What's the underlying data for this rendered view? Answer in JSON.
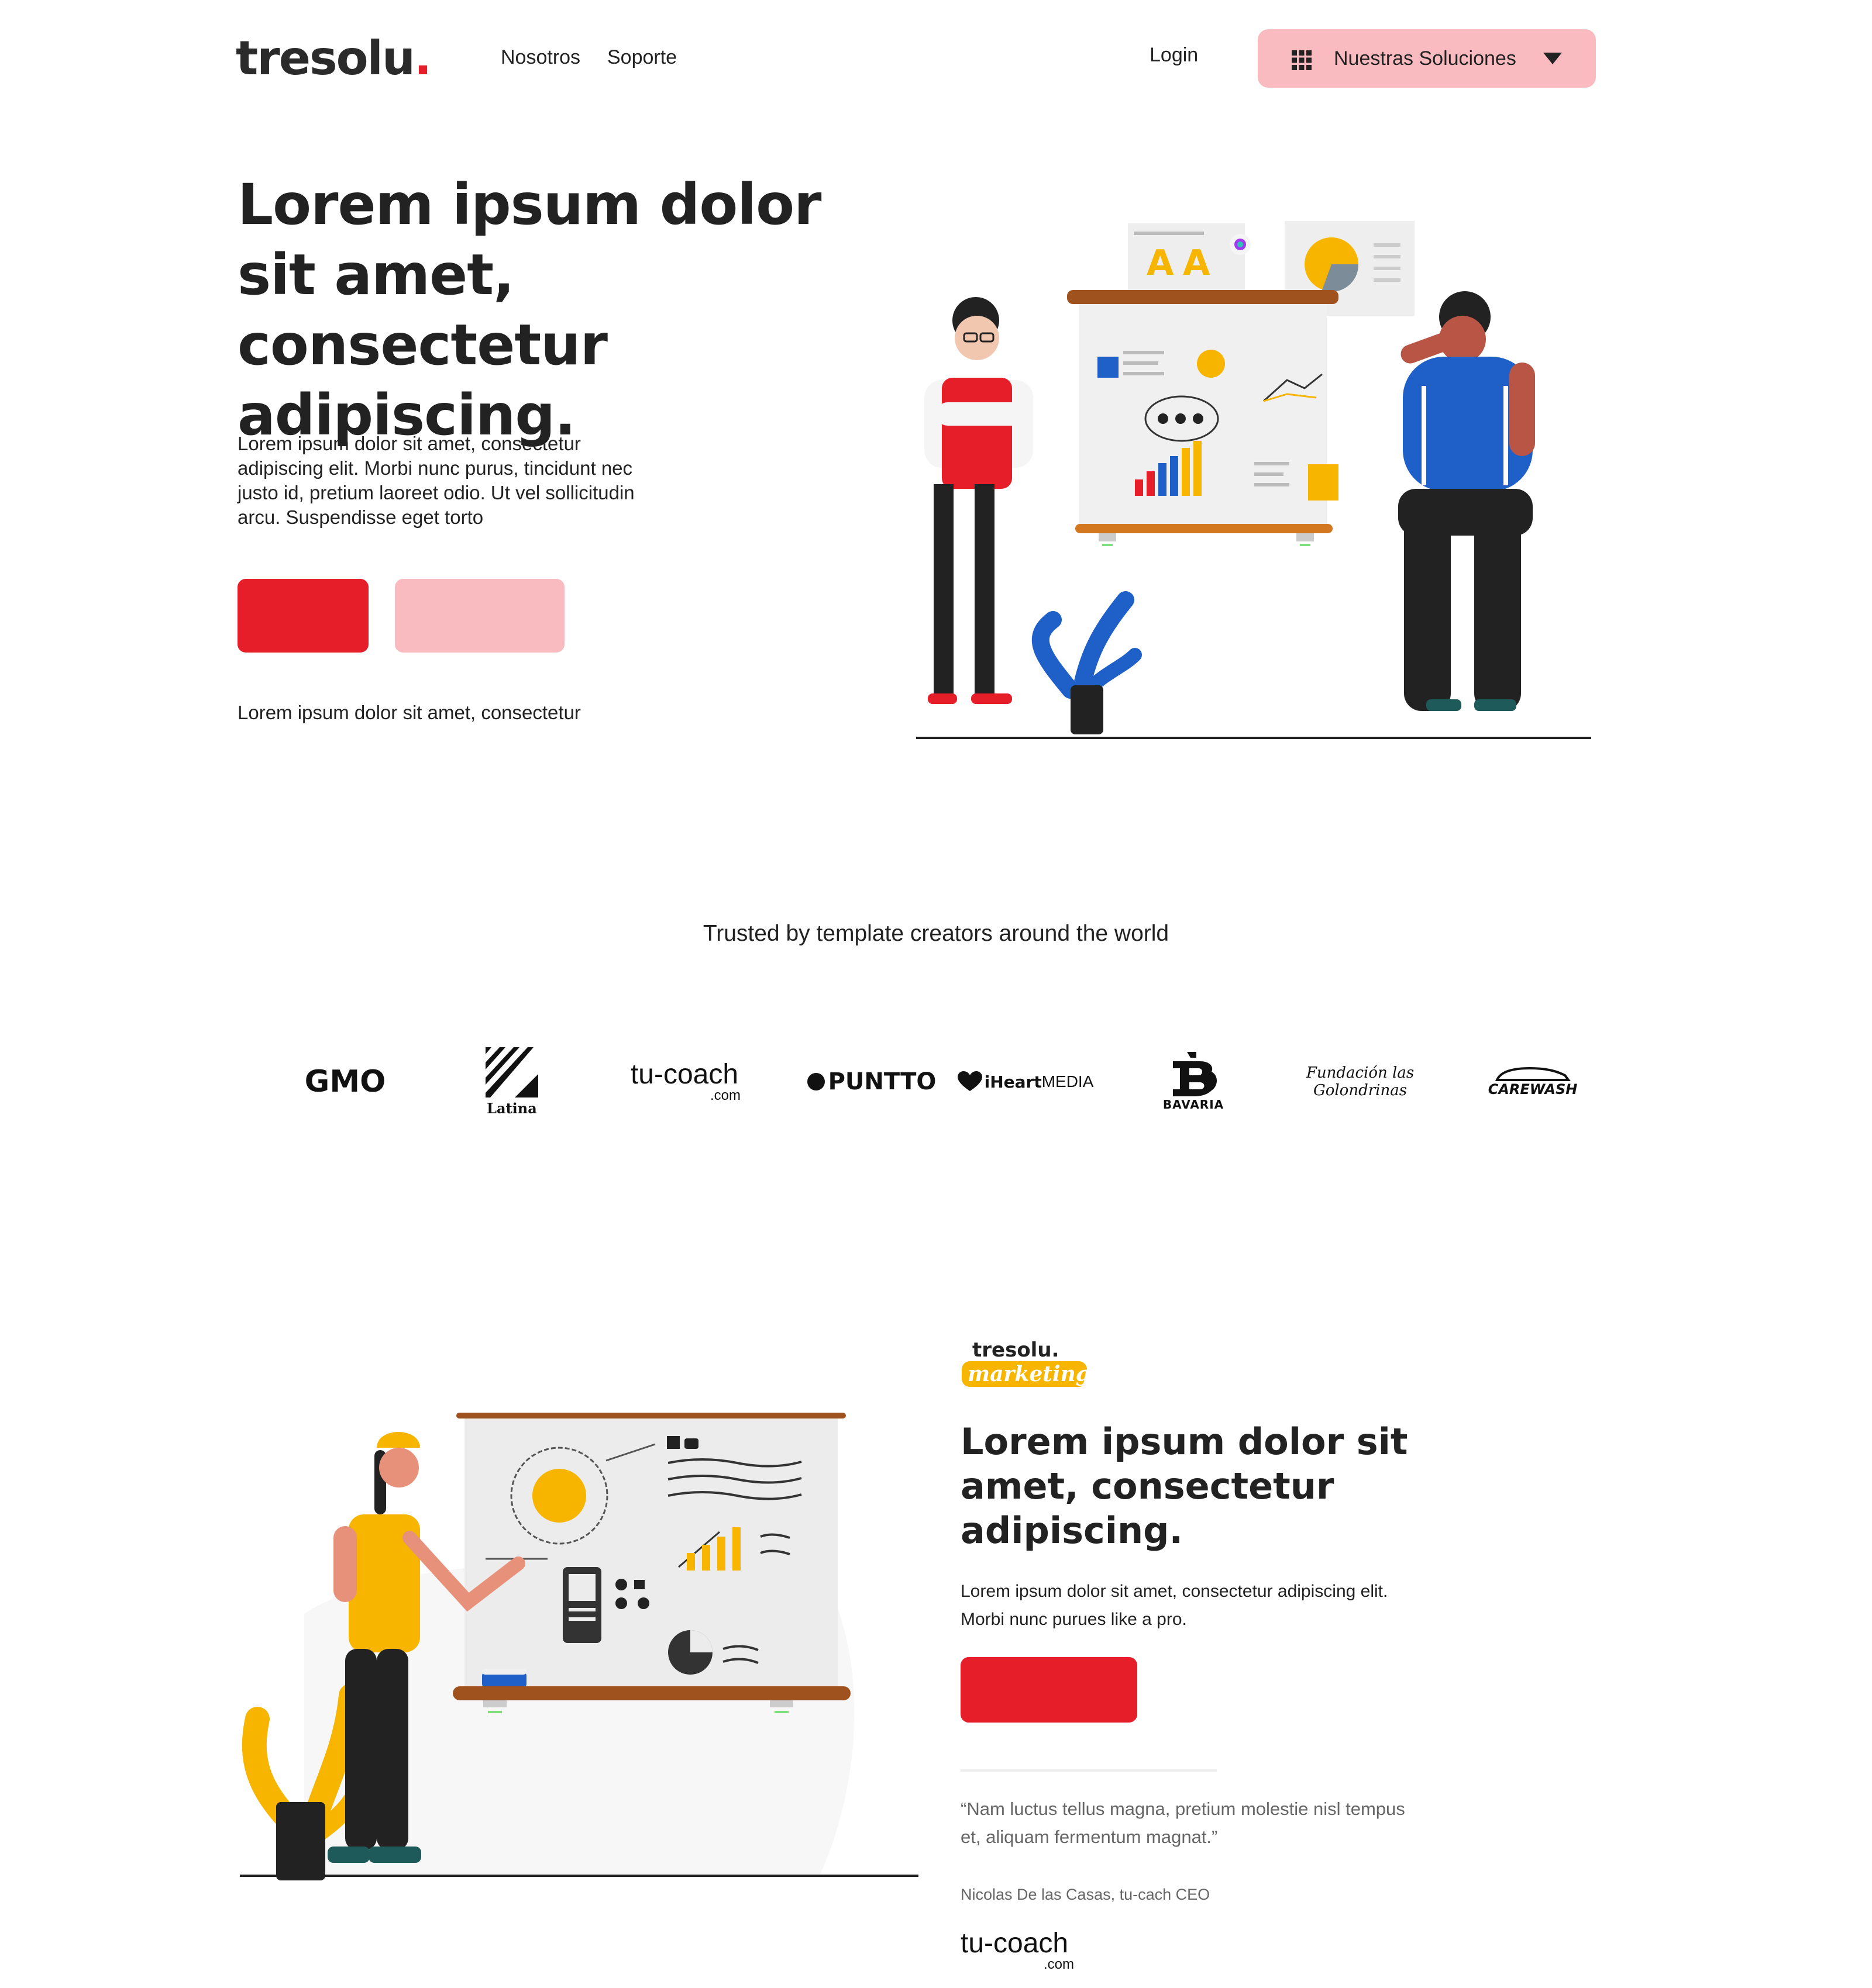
{
  "header": {
    "logo_text": "tresolu",
    "logo_dot": ".",
    "nav": [
      "Nosotros",
      "Soporte"
    ],
    "login": "Login",
    "solutions_label": "Nuestras Soluciones"
  },
  "hero": {
    "title": "Lorem ipsum dolor sit amet, consectetur adipiscing.",
    "description": "Lorem ipsum dolor sit amet, consectetur adipiscing elit. Morbi nunc purus, tincidunt nec justo id, pretium laoreet odio. Ut vel sollicitudin arcu. Suspendisse eget torto",
    "note": "Lorem ipsum dolor sit amet, consectetur"
  },
  "trusted": {
    "heading": "Trusted by template creators around the world",
    "logos": [
      {
        "text": "GMO"
      },
      {
        "text": "Latina"
      },
      {
        "text": "tu-coach",
        "sub": ".com"
      },
      {
        "text": "PUNTTO"
      },
      {
        "text": "iHeart",
        "sub": "MEDIA"
      },
      {
        "text": "BAVARIA"
      },
      {
        "text": "Fundación las Golondrinas"
      },
      {
        "text": "CAREWASH"
      }
    ]
  },
  "marketing": {
    "logo_top": "tresolu.",
    "logo_bottom": "marketing",
    "title": "Lorem ipsum dolor sit amet, consectetur adipiscing.",
    "description": "Lorem ipsum dolor sit amet, consectetur adipiscing elit. Morbi nunc purues like a pro.",
    "quote": "“Nam luctus tellus magna, pretium molestie nisl tempus et, aliquam fermentum magnat.”",
    "quote_author": "Nicolas De las Casas, tu-cach CEO",
    "quote_logo": "tu-coach",
    "quote_logo_sub": ".com"
  },
  "colors": {
    "accent_red": "#e51e2a",
    "accent_pink": "#f9bbc0",
    "text_dark": "#222222",
    "text_muted": "#666666",
    "illustration_yellow": "#f7b500",
    "illustration_blue": "#1e5fc8",
    "board_brown": "#a0521e"
  },
  "icons": [
    "grid-icon",
    "caret-down-icon"
  ]
}
